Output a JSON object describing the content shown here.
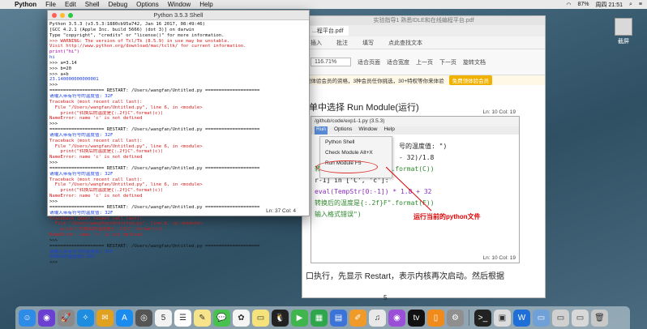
{
  "menubar": {
    "apple": "",
    "items": [
      "Python",
      "File",
      "Edit",
      "Shell",
      "Debug",
      "Options",
      "Window",
      "Help"
    ],
    "battery": "87%",
    "clock": "周四 21:51"
  },
  "shell": {
    "title": "Python 3.5.3 Shell",
    "lines": [
      {
        "t": "Python 3.5.3 (v3.5.3:1880cb95a742, Jan 16 2017, 08:49:46)",
        "c": "k"
      },
      {
        "t": "[GCC 4.2.1 (Apple Inc. build 5666) (dot 3)] on darwin",
        "c": "k"
      },
      {
        "t": "Type \"copyright\", \"credits\" or \"license()\" for more information.",
        "c": "k"
      },
      {
        "t": ">>> WARNING: The version of Tcl/Tk (8.5.9) in use may be unstable.",
        "c": "r"
      },
      {
        "t": "Visit http://www.python.org/download/mac/tcltk/ for current information.",
        "c": "r"
      },
      {
        "t": "print(\"hi\")",
        "c": "o"
      },
      {
        "t": "hi",
        "c": "b"
      },
      {
        "t": ">>> a=3.14",
        "c": "k"
      },
      {
        "t": ">>> b=20",
        "c": "k"
      },
      {
        "t": ">>> a+b",
        "c": "k"
      },
      {
        "t": "23.140000000000001",
        "c": "b"
      },
      {
        "t": ">>>",
        "c": "k"
      },
      {
        "t": "==================== RESTART: /Users/wangfan/Untitled.py ====================",
        "c": "k"
      },
      {
        "t": "请输入带有符号的温度值: 32F",
        "c": "b"
      },
      {
        "t": "Traceback (most recent call last):",
        "c": "r"
      },
      {
        "t": "  File \"/Users/wangfan/Untitled.py\", line 6, in <module>",
        "c": "r"
      },
      {
        "t": "    print(\"转换后的温度是{:.2f}C\".format(c))",
        "c": "r"
      },
      {
        "t": "NameError: name 'c' is not defined",
        "c": "r"
      },
      {
        "t": ">>>",
        "c": "k"
      },
      {
        "t": "==================== RESTART: /Users/wangfan/Untitled.py ====================",
        "c": "k"
      },
      {
        "t": "请输入带有符号的温度值: 32F",
        "c": "b"
      },
      {
        "t": "Traceback (most recent call last):",
        "c": "r"
      },
      {
        "t": "  File \"/Users/wangfan/Untitled.py\", line 6, in <module>",
        "c": "r"
      },
      {
        "t": "    print(\"转换后的温度是{:.2f}C\".format(c))",
        "c": "r"
      },
      {
        "t": "NameError: name 'c' is not defined",
        "c": "r"
      },
      {
        "t": ">>>",
        "c": "k"
      },
      {
        "t": "==================== RESTART: /Users/wangfan/Untitled.py ====================",
        "c": "k"
      },
      {
        "t": "请输入带有符号的温度值: 32F",
        "c": "b"
      },
      {
        "t": "Traceback (most recent call last):",
        "c": "r"
      },
      {
        "t": "  File \"/Users/wangfan/Untitled.py\", line 6, in <module>",
        "c": "r"
      },
      {
        "t": "    print(\"转换后的温度是{:.2f}C\".format(c))",
        "c": "r"
      },
      {
        "t": "NameError: name 'c' is not defined",
        "c": "r"
      },
      {
        "t": ">>>",
        "c": "k"
      },
      {
        "t": "==================== RESTART: /Users/wangfan/Untitled.py ====================",
        "c": "k"
      },
      {
        "t": "请输入带有符号的温度值: 32F",
        "c": "b"
      },
      {
        "t": "Traceback (most recent call last):",
        "c": "r"
      },
      {
        "t": "  File \"/Users/wangfan/Untitled.py\", line 6, in <module>",
        "c": "r"
      },
      {
        "t": "    print(\"转换后的温度是{:.2f}C\".format(c))",
        "c": "r"
      },
      {
        "t": "NameError: name 'c' is not defined",
        "c": "r"
      },
      {
        "t": ">>>",
        "c": "k"
      },
      {
        "t": "==================== RESTART: /Users/wangfan/Untitled.py ====================",
        "c": "k"
      },
      {
        "t": "请输入带有符号的温度值: 32F",
        "c": "b"
      },
      {
        "t": "转换后的温度是0.00C",
        "c": "b"
      },
      {
        "t": ">>>",
        "c": "k"
      }
    ],
    "status": "Ln: 37  Col: 4"
  },
  "pdf": {
    "title": "实验指导1 熟悉IDLE和在线编程平台.pdf",
    "tab": "...程平台.pdf",
    "toolbar1": [
      "插入",
      "批注",
      "填写",
      "点此查找文本"
    ],
    "zoom": "116.71%",
    "toolbar2": [
      "适合页面",
      "适合宽度",
      "上一页",
      "下一页",
      "旋转文档",
      "放大",
      "缩小"
    ],
    "banner": "费体验会员的资格，3种会员任你挑选，30+特权等你来体验",
    "banner_btn": "免费领体验会员",
    "heading": "单中选择 Run Module(运行)",
    "body": "口执行，先显示 Restart，表示内核再次启动。然后根据",
    "page": "5",
    "embed": {
      "path": "/github/code/exp1-1.py (3.5.3)",
      "menus": [
        "Run",
        "Options",
        "Window",
        "Help"
      ],
      "status_top": "Ln: 10  Col: 19",
      "dropdown": [
        "Python Shell",
        "Check Module  Alt+X",
        "Run Module      F5"
      ],
      "code": [
        "号的温度值: \")",
        "- 32)/1.8",
        "转换后的温度是{:.2f}C\".format(C))",
        "r-1] in ['C', 'c']:",
        "eval(TempStr[0:-1]) * 1.8 + 32",
        "转换后的温度是{:.2f}F\".format(F))",
        "输入格式错误\")"
      ],
      "annotation": "运行当前的python文件",
      "status": "Ln: 10  Col: 19"
    }
  },
  "rightpanel": {
    "label": "截屏"
  },
  "dock": {
    "icons": [
      {
        "name": "finder-icon",
        "color": "#2e8be6",
        "glyph": "☺"
      },
      {
        "name": "siri-icon",
        "color": "#6b3fd1",
        "glyph": "◉"
      },
      {
        "name": "launchpad-icon",
        "color": "#8a8a8a",
        "glyph": "🚀"
      },
      {
        "name": "safari-icon",
        "color": "#1e8de0",
        "glyph": "✧"
      },
      {
        "name": "photos-preview-icon",
        "color": "#e0a020",
        "glyph": "✉"
      },
      {
        "name": "app-store-icon",
        "color": "#1a8cf0",
        "glyph": "A"
      },
      {
        "name": "image-capture-icon",
        "color": "#555555",
        "glyph": "◎"
      },
      {
        "name": "calendar-icon",
        "color": "#f2f2f2",
        "glyph": "5"
      },
      {
        "name": "reminders-icon",
        "color": "#ffffff",
        "glyph": "☰"
      },
      {
        "name": "notes-icon",
        "color": "#f7e38a",
        "glyph": "✎"
      },
      {
        "name": "messages-icon",
        "color": "#48c24f",
        "glyph": "💬"
      },
      {
        "name": "photos-icon",
        "color": "#f4f4f4",
        "glyph": "✿"
      },
      {
        "name": "stickies-icon",
        "color": "#f6e27a",
        "glyph": "▭"
      },
      {
        "name": "qq-icon",
        "color": "#222222",
        "glyph": "🐧"
      },
      {
        "name": "facetime-icon",
        "color": "#3fb54c",
        "glyph": "▶"
      },
      {
        "name": "numbers-icon",
        "color": "#2fa64b",
        "glyph": "▦"
      },
      {
        "name": "keynote-icon",
        "color": "#3b73d6",
        "glyph": "▤"
      },
      {
        "name": "pages-icon",
        "color": "#f09a2a",
        "glyph": "✐"
      },
      {
        "name": "itunes-icon",
        "color": "#e8e8e8",
        "glyph": "♫"
      },
      {
        "name": "podcasts-icon",
        "color": "#9b4fd6",
        "glyph": "◉"
      },
      {
        "name": "apple-tv-icon",
        "color": "#111111",
        "glyph": "tv"
      },
      {
        "name": "books-icon",
        "color": "#f08a1a",
        "glyph": "▯"
      },
      {
        "name": "system-preferences-icon",
        "color": "#8f8f8f",
        "glyph": "⚙"
      },
      {
        "name": "terminal-icon",
        "color": "#222222",
        "glyph": ">_"
      },
      {
        "name": "preview-icon",
        "color": "#dcdcdc",
        "glyph": "▣"
      },
      {
        "name": "wps-icon",
        "color": "#1f6fd9",
        "glyph": "W"
      },
      {
        "name": "downloads-icon",
        "color": "#6fa0d8",
        "glyph": "▭"
      },
      {
        "name": "python-window-icon",
        "color": "#d0d0d0",
        "glyph": "▭"
      },
      {
        "name": "window-thumb-icon",
        "color": "#d8d8d8",
        "glyph": "▭"
      },
      {
        "name": "trash-icon",
        "color": "#c8c8c8",
        "glyph": "🗑"
      }
    ]
  }
}
